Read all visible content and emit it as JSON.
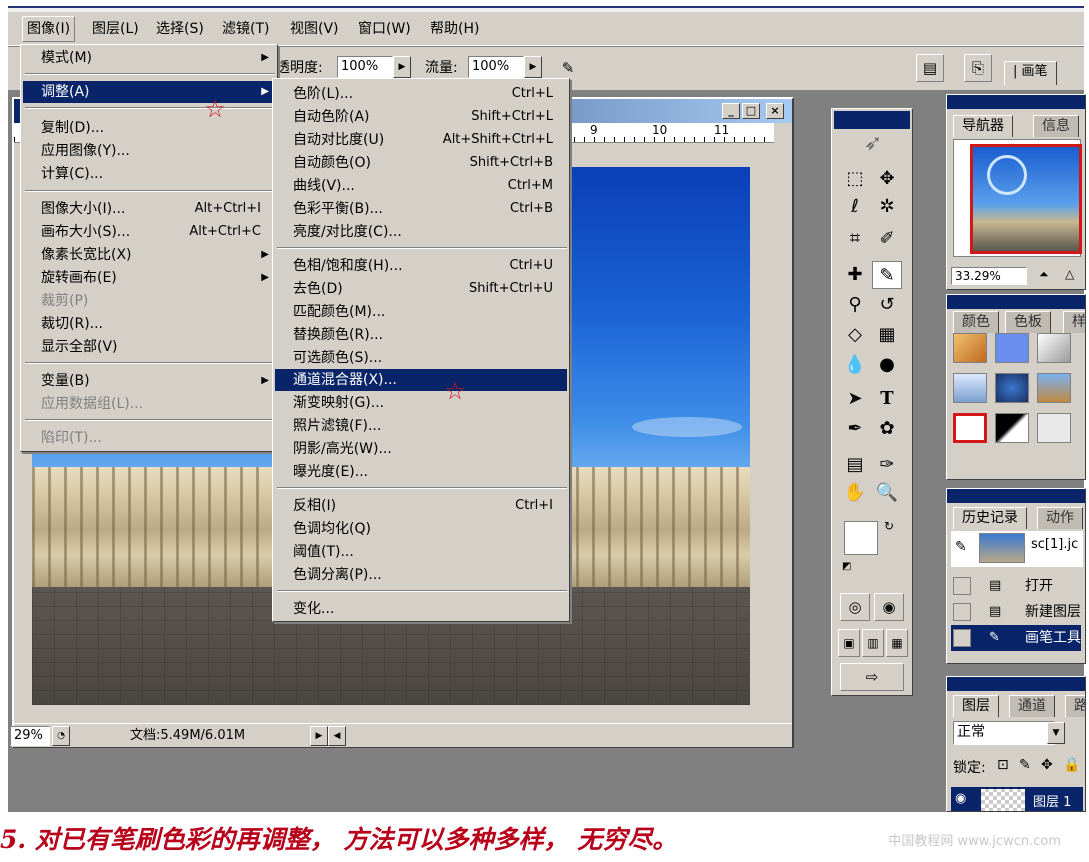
{
  "menubar": {
    "items": [
      "图像(I)",
      "图层(L)",
      "选择(S)",
      "滤镜(T)",
      "视图(V)",
      "窗口(W)",
      "帮助(H)"
    ]
  },
  "options": {
    "opacity_label": "透明度:",
    "opacity_value": "100%",
    "flow_label": "流量:",
    "flow_value": "100%",
    "brush_tab": "画笔"
  },
  "image_menu": {
    "items": [
      {
        "label": "模式(M)",
        "submenu": true
      },
      {
        "label": "调整(A)",
        "submenu": true,
        "highlighted": true
      },
      {
        "label": "复制(D)..."
      },
      {
        "label": "应用图像(Y)..."
      },
      {
        "label": "计算(C)..."
      },
      {
        "label": "图像大小(I)...",
        "shortcut": "Alt+Ctrl+I"
      },
      {
        "label": "画布大小(S)...",
        "shortcut": "Alt+Ctrl+C"
      },
      {
        "label": "像素长宽比(X)",
        "submenu": true
      },
      {
        "label": "旋转画布(E)",
        "submenu": true
      },
      {
        "label": "裁剪(P)",
        "disabled": true
      },
      {
        "label": "裁切(R)..."
      },
      {
        "label": "显示全部(V)"
      },
      {
        "label": "变量(B)",
        "submenu": true
      },
      {
        "label": "应用数据组(L)...",
        "disabled": true
      },
      {
        "label": "陷印(T)...",
        "disabled": true
      }
    ]
  },
  "adjust_menu": {
    "items": [
      {
        "label": "色阶(L)...",
        "shortcut": "Ctrl+L"
      },
      {
        "label": "自动色阶(A)",
        "shortcut": "Shift+Ctrl+L"
      },
      {
        "label": "自动对比度(U)",
        "shortcut": "Alt+Shift+Ctrl+L"
      },
      {
        "label": "自动颜色(O)",
        "shortcut": "Shift+Ctrl+B"
      },
      {
        "label": "曲线(V)...",
        "shortcut": "Ctrl+M"
      },
      {
        "label": "色彩平衡(B)...",
        "shortcut": "Ctrl+B"
      },
      {
        "label": "亮度/对比度(C)..."
      },
      {
        "label": "色相/饱和度(H)...",
        "shortcut": "Ctrl+U"
      },
      {
        "label": "去色(D)",
        "shortcut": "Shift+Ctrl+U"
      },
      {
        "label": "匹配颜色(M)..."
      },
      {
        "label": "替换颜色(R)..."
      },
      {
        "label": "可选颜色(S)..."
      },
      {
        "label": "通道混合器(X)...",
        "highlighted": true
      },
      {
        "label": "渐变映射(G)..."
      },
      {
        "label": "照片滤镜(F)..."
      },
      {
        "label": "阴影/高光(W)..."
      },
      {
        "label": "曝光度(E)..."
      },
      {
        "label": "反相(I)",
        "shortcut": "Ctrl+I"
      },
      {
        "label": "色调均化(Q)"
      },
      {
        "label": "阈值(T)..."
      },
      {
        "label": "色调分离(P)..."
      },
      {
        "label": "变化..."
      }
    ]
  },
  "document": {
    "ruler_marks": [
      "9",
      "10",
      "11"
    ],
    "zoom": "29%",
    "doc_info": "文档:5.49M/6.01M"
  },
  "navigator": {
    "tabs": [
      "导航器",
      "信息"
    ],
    "zoom": "33.29%"
  },
  "swatches": {
    "tabs": [
      "颜色",
      "色板",
      "样"
    ]
  },
  "history": {
    "tabs": [
      "历史记录",
      "动作"
    ],
    "snapshot": "sc[1].jc",
    "items": [
      "打开",
      "新建图层",
      "画笔工具"
    ]
  },
  "layers": {
    "tabs": [
      "图层",
      "通道",
      "路"
    ],
    "blend_mode": "正常",
    "lock_label": "锁定:",
    "layer_name": "图层 1"
  },
  "caption": {
    "text": "5. 对已有笔刷色彩的再调整， 方法可以多种多样， 无穷尽。",
    "watermark": "中国教程网 www.jcwcn.com"
  },
  "colors": {
    "menu_highlight": "#0a246a",
    "caption": "#b8001a",
    "star": "#d01818"
  }
}
